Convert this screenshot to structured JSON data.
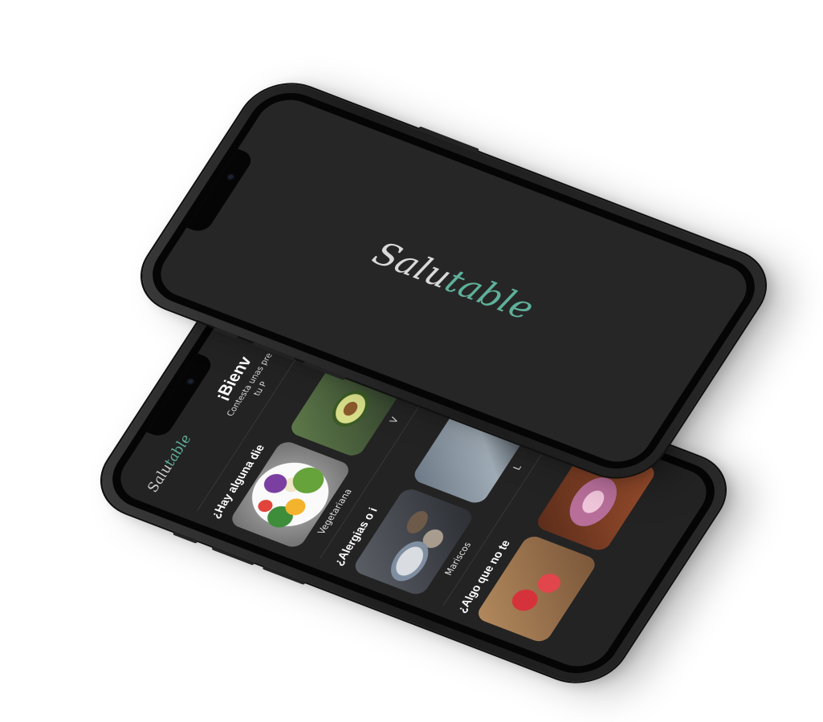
{
  "splash": {
    "logo_main": "Salu",
    "logo_accent": "table"
  },
  "questionnaire": {
    "logo_main": "Salu",
    "logo_accent": "table",
    "welcome_title": "¡Bienv",
    "welcome_sub_line1": "Contesta unas pre",
    "welcome_sub_line2": "tu P",
    "sections": [
      {
        "title": "¿Hay alguna die",
        "search_icon": "search-icon",
        "cards": [
          {
            "label": "Vegetariana",
            "image": "vegetarian-bowl"
          },
          {
            "label": "V",
            "image": "avocado"
          }
        ]
      },
      {
        "title": "¿Alergias o i",
        "search_icon": "search-icon",
        "cards": [
          {
            "label": "Mariscos",
            "image": "seafood"
          },
          {
            "label": "L",
            "image": "dairy"
          }
        ]
      },
      {
        "title": "¿Algo que no te",
        "search_icon": "search-icon",
        "cards": [
          {
            "label": "",
            "image": "strawberries"
          },
          {
            "label": "",
            "image": "red-onion"
          },
          {
            "label": "",
            "image": "herbs"
          }
        ]
      }
    ]
  },
  "colors": {
    "screen_bg": "#232323",
    "logo_accent": "#5fb09a",
    "text": "#ffffff"
  }
}
